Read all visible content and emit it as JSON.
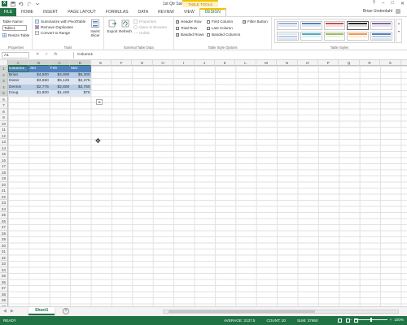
{
  "window": {
    "title": "1st Qtr Sales - Excel",
    "context_label": "TABLE TOOLS",
    "help": "?",
    "minimize": "–",
    "restore": "□",
    "close": "✕"
  },
  "user": {
    "name": "Brian Underdahl"
  },
  "tabs": {
    "file": "FILE",
    "items": [
      "HOME",
      "INSERT",
      "PAGE LAYOUT",
      "FORMULAS",
      "DATA",
      "REVIEW",
      "VIEW"
    ],
    "design": "DESIGN"
  },
  "ribbon": {
    "properties": {
      "table_name_label": "Table Name:",
      "table_name_value": "Table1",
      "resize": "Resize Table",
      "group": "Properties"
    },
    "tools": {
      "summarize": "Summarize with PivotTable",
      "remove_duplicates": "Remove Duplicates",
      "convert": "Convert to Range",
      "insert_slicer": "Insert Slicer",
      "group": "Tools"
    },
    "external": {
      "export": "Export",
      "refresh": "Refresh",
      "properties": "Properties",
      "open_browser": "Open in Browser",
      "unlink": "Unlink",
      "group": "External Table Data"
    },
    "style_options": {
      "header_row": "Header Row",
      "total_row": "Total Row",
      "banded_rows": "Banded Rows",
      "first_column": "First Column",
      "last_column": "Last Column",
      "banded_columns": "Banded Columns",
      "filter_button": "Filter Button",
      "group": "Table Style Options"
    },
    "styles": {
      "group": "Table Styles"
    }
  },
  "formula_bar": {
    "name_box": "A1",
    "fx": "fx",
    "formula": "Column1"
  },
  "columns": [
    "A",
    "B",
    "C",
    "D",
    "E",
    "F",
    "G",
    "H",
    "I",
    "J",
    "K",
    "L",
    "M",
    "N",
    "O",
    "P",
    "Q",
    "R",
    "S",
    "T"
  ],
  "rows": [
    "1",
    "2",
    "3",
    "4",
    "5",
    "6",
    "7",
    "8",
    "9",
    "10",
    "11",
    "12",
    "13",
    "14",
    "15",
    "16",
    "17",
    "18",
    "19",
    "20",
    "21",
    "22",
    "23",
    "24",
    "25",
    "26",
    "27",
    "28",
    "29",
    "30",
    "31",
    "32",
    "33",
    "34",
    "35",
    "36",
    "37",
    "38",
    "39",
    "40"
  ],
  "table": {
    "headers": [
      "Column1",
      "Jan",
      "Feb",
      "Mar"
    ],
    "rows": [
      [
        "Brian",
        "$4,500",
        "$4,900",
        "$5,300"
      ],
      [
        "Dieter",
        "$3,850",
        "$5,125",
        "$2,375"
      ],
      [
        "Dennis",
        "$2,775",
        "$2,800",
        "$2,750"
      ],
      [
        "Doug",
        "$1,800",
        "$1,400",
        "$75"
      ]
    ]
  },
  "sheets": {
    "active": "Sheet1",
    "add": "+"
  },
  "status": {
    "ready": "READY",
    "average": "AVERAGE: 3137.5",
    "count": "COUNT: 20",
    "sum": "SUM: 37650",
    "zoom": "100%"
  },
  "colors": {
    "accent": "#217346",
    "table_header": "#4f81bd",
    "table_band": "#b8cce4",
    "context_tab": "#f2c200"
  }
}
